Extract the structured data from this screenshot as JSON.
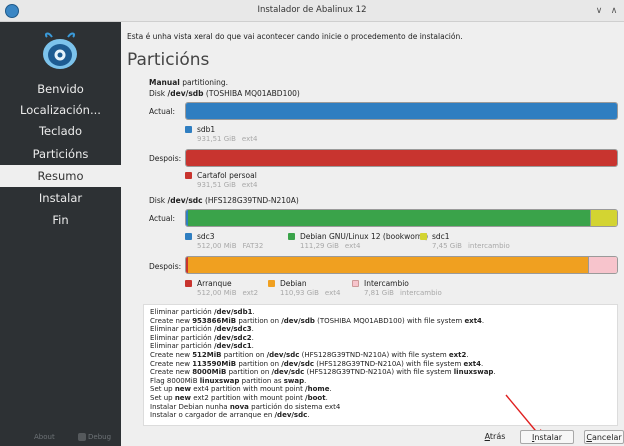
{
  "window": {
    "title": "Instalador de Abalinux 12",
    "minimize_glyph": "∨",
    "maximize_glyph": "∧"
  },
  "sidebar": {
    "items": [
      {
        "label": "Benvido",
        "active": false
      },
      {
        "label": "Localización...",
        "active": false
      },
      {
        "label": "Teclado",
        "active": false
      },
      {
        "label": "Particións",
        "active": false
      },
      {
        "label": "Resumo",
        "active": true
      },
      {
        "label": "Instalar",
        "active": false
      },
      {
        "label": "Fin",
        "active": false
      }
    ],
    "footer": {
      "about": "About",
      "debug": "Debug"
    }
  },
  "main": {
    "intro": "Esta é unha vista xeral do que vai acontecer cando inicie o procedemento de instalación.",
    "heading": "Particións",
    "mode_bold": "Manual",
    "mode_rest": " partitioning.",
    "disk1": {
      "prefix": "Disk ",
      "dev": "/dev/sdb",
      "model": " (TOSHIBA MQ01ABD100)"
    },
    "disk2": {
      "prefix": "Disk ",
      "dev": "/dev/sdc",
      "model": " (HFS128G39TND-N210A)"
    },
    "actual_label": "Actual:",
    "despois_label": "Despois:",
    "disk1_actual_legend": [
      {
        "name": "sdb1",
        "size": "931,51 GiB",
        "fs": "ext4",
        "color": "#2f7ec1"
      }
    ],
    "disk1_after_legend": [
      {
        "name": "Cartafol persoal",
        "size": "931,51 GiB",
        "fs": "ext4",
        "color": "#c8342f"
      }
    ],
    "disk2_actual_legend": [
      {
        "name": "sdc3",
        "size": "512,00 MiB",
        "fs": "FAT32",
        "color": "#2f7ec1"
      },
      {
        "name": "Debian GNU/Linux 12 (bookworm)",
        "size": "111,29 GiB",
        "fs": "ext4",
        "color": "#3aa34a"
      },
      {
        "name": "sdc1",
        "size": "7,45 GiB",
        "fs": "intercambio",
        "color": "#d3d432"
      }
    ],
    "disk2_after_legend": [
      {
        "name": "Arranque",
        "size": "512,00 MiB",
        "fs": "ext2",
        "color": "#c8342f"
      },
      {
        "name": "Debian",
        "size": "110,93 GiB",
        "fs": "ext4",
        "color": "#f0a020"
      },
      {
        "name": "Intercambio",
        "size": "7,81 GiB",
        "fs": "intercambio",
        "color": "#f7c4cc"
      }
    ],
    "summary_lines": [
      [
        {
          "t": "Eliminar partición "
        },
        {
          "t": "/dev/sdb1",
          "b": true
        },
        {
          "t": "."
        }
      ],
      [
        {
          "t": "Create new "
        },
        {
          "t": "953866MiB",
          "b": true
        },
        {
          "t": " partition on "
        },
        {
          "t": "/dev/sdb",
          "b": true
        },
        {
          "t": " (TOSHIBA MQ01ABD100) with file system "
        },
        {
          "t": "ext4",
          "b": true
        },
        {
          "t": "."
        }
      ],
      [
        {
          "t": "Eliminar partición "
        },
        {
          "t": "/dev/sdc3",
          "b": true
        },
        {
          "t": "."
        }
      ],
      [
        {
          "t": "Eliminar partición "
        },
        {
          "t": "/dev/sdc2",
          "b": true
        },
        {
          "t": "."
        }
      ],
      [
        {
          "t": "Eliminar partición "
        },
        {
          "t": "/dev/sdc1",
          "b": true
        },
        {
          "t": "."
        }
      ],
      [
        {
          "t": "Create new "
        },
        {
          "t": "512MiB",
          "b": true
        },
        {
          "t": " partition on "
        },
        {
          "t": "/dev/sdc",
          "b": true
        },
        {
          "t": " (HFS128G39TND-N210A) with file system "
        },
        {
          "t": "ext2",
          "b": true
        },
        {
          "t": "."
        }
      ],
      [
        {
          "t": "Create new "
        },
        {
          "t": "113590MiB",
          "b": true
        },
        {
          "t": " partition on "
        },
        {
          "t": "/dev/sdc",
          "b": true
        },
        {
          "t": " (HFS128G39TND-N210A) with file system "
        },
        {
          "t": "ext4",
          "b": true
        },
        {
          "t": "."
        }
      ],
      [
        {
          "t": "Create new "
        },
        {
          "t": "8000MiB",
          "b": true
        },
        {
          "t": " partition on "
        },
        {
          "t": "/dev/sdc",
          "b": true
        },
        {
          "t": " (HFS128G39TND-N210A) with file system "
        },
        {
          "t": "linuxswap",
          "b": true
        },
        {
          "t": "."
        }
      ],
      [
        {
          "t": "Flag 8000MiB "
        },
        {
          "t": "linuxswap",
          "b": true
        },
        {
          "t": " partition as "
        },
        {
          "t": "swap",
          "b": true
        },
        {
          "t": "."
        }
      ],
      [
        {
          "t": "Set up "
        },
        {
          "t": "new",
          "b": true
        },
        {
          "t": " ext4 partition with mount point "
        },
        {
          "t": "/home",
          "b": true
        },
        {
          "t": "."
        }
      ],
      [
        {
          "t": "Set up "
        },
        {
          "t": "new",
          "b": true
        },
        {
          "t": " ext2 partition with mount point "
        },
        {
          "t": "/boot",
          "b": true
        },
        {
          "t": "."
        }
      ],
      [
        {
          "t": "Instalar Debian nunha "
        },
        {
          "t": "nova",
          "b": true
        },
        {
          "t": " partición do sistema ext4"
        }
      ],
      [
        {
          "t": "Instalar o cargador de arranque en "
        },
        {
          "t": "/dev/sdc",
          "b": true
        },
        {
          "t": "."
        }
      ]
    ]
  },
  "buttons": {
    "back": {
      "accel": "A",
      "rest": "trás"
    },
    "install": {
      "accel": "I",
      "rest": "nstalar"
    },
    "cancel": {
      "accel": "C",
      "rest": "ancelar"
    }
  },
  "bars": {
    "disk1_actual": [
      {
        "fraction": 1.0,
        "color": "#2f7ec1"
      }
    ],
    "disk1_after": [
      {
        "fraction": 1.0,
        "color": "#c8342f"
      }
    ],
    "disk2_actual": [
      {
        "fraction": 0.0042,
        "color": "#2f7ec1"
      },
      {
        "fraction": 0.9328,
        "color": "#3aa34a"
      },
      {
        "fraction": 0.063,
        "color": "#d3d432"
      }
    ],
    "disk2_after": [
      {
        "fraction": 0.0042,
        "color": "#c8342f"
      },
      {
        "fraction": 0.9291,
        "color": "#f0a020"
      },
      {
        "fraction": 0.0667,
        "color": "#f7c4cc"
      }
    ]
  }
}
